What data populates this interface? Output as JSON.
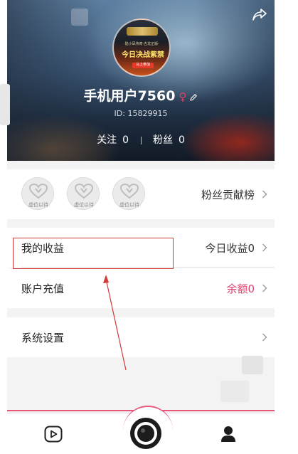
{
  "profile": {
    "username": "手机用户7560",
    "gender_symbol": "♀",
    "uid": "ID: 15829915",
    "following_label": "关注",
    "following_count": "0",
    "fans_label": "粉丝",
    "fans_count": "0",
    "avatar_promo": "今日决战紫禁",
    "avatar_small_text": "·陆小凤传奇·古龙正版·",
    "avatar_cta": "马上参加"
  },
  "fan_badges": [
    {
      "text": "虚位以待"
    },
    {
      "text": "虚位以待"
    },
    {
      "text": "虚位以待"
    }
  ],
  "fans_ranking_label": "粉丝贡献榜",
  "menu": {
    "earnings_label": "我的收益",
    "earnings_value": "今日收益0",
    "recharge_label": "账户充值",
    "recharge_value": "余额0",
    "settings_label": "系统设置"
  },
  "icons": {
    "share": "share-icon",
    "edit": "edit-pencil-icon",
    "chevron": "chevron-right-icon",
    "video_tab": "video-tab-icon",
    "camera_tab": "camera-record-icon",
    "me_tab": "user-profile-icon"
  },
  "colors": {
    "accent_pink": "#e0406b",
    "highlight_red": "#d23a3a",
    "nav_line": "#e85578"
  }
}
